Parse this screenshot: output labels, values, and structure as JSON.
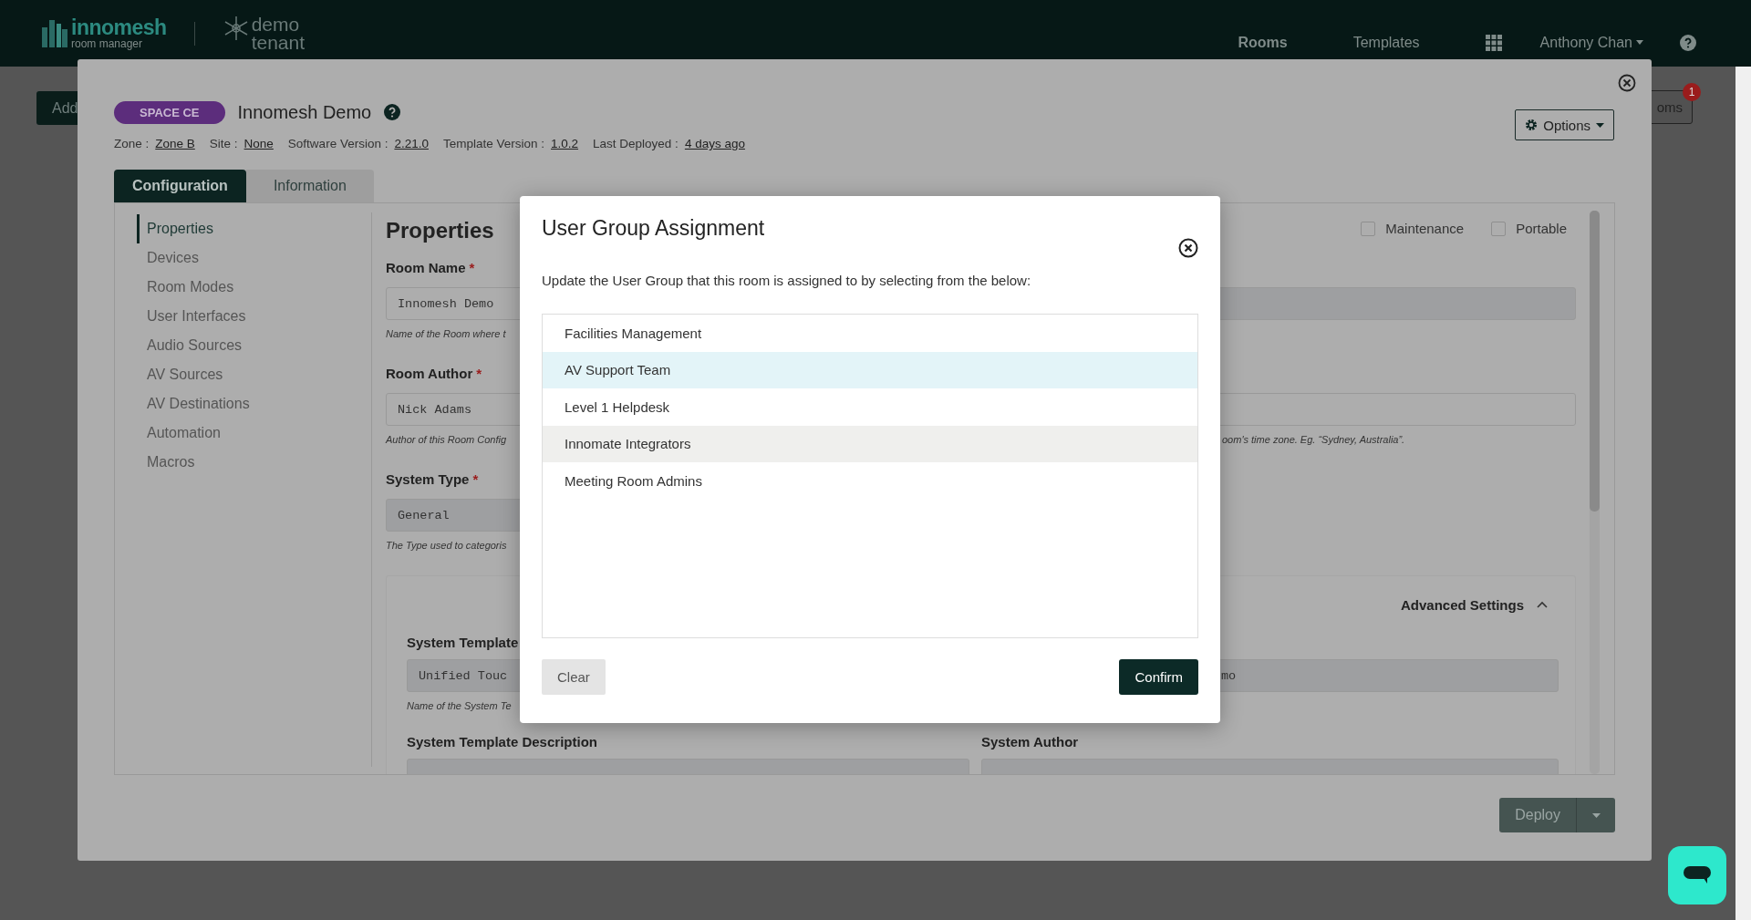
{
  "top_bar": {
    "logo": {
      "name": "innomesh",
      "tagline": "room manager"
    },
    "tenant": [
      "demo",
      "tenant"
    ],
    "nav": [
      {
        "label": "Rooms",
        "selected": true
      },
      {
        "label": "Templates",
        "selected": false
      }
    ],
    "user": "Anthony Chan"
  },
  "background": {
    "add_button": "Add",
    "rooms_button": "oms",
    "rooms_badge": "1"
  },
  "room_modal": {
    "badge": "SPACE CE",
    "title": "Innomesh Demo",
    "meta": [
      {
        "label": "Zone :",
        "value": "Zone B"
      },
      {
        "label": "Site :",
        "value": "None"
      },
      {
        "label": "Software Version :",
        "value": "2.21.0"
      },
      {
        "label": "Template Version :",
        "value": "1.0.2"
      },
      {
        "label": "Last Deployed :",
        "value": "4 days ago"
      }
    ],
    "options_button": "Options",
    "tabs": [
      {
        "label": "Configuration",
        "selected": true
      },
      {
        "label": "Information",
        "selected": false
      }
    ],
    "sidebar": {
      "items": [
        {
          "label": "Properties",
          "selected": true
        },
        {
          "label": "Devices",
          "selected": false
        },
        {
          "label": "Room Modes",
          "selected": false
        },
        {
          "label": "User Interfaces",
          "selected": false
        },
        {
          "label": "Audio Sources",
          "selected": false
        },
        {
          "label": "AV Sources",
          "selected": false
        },
        {
          "label": "AV Destinations",
          "selected": false
        },
        {
          "label": "Automation",
          "selected": false
        },
        {
          "label": "Macros",
          "selected": false
        }
      ]
    },
    "properties": {
      "heading": "Properties",
      "flags": [
        {
          "label": "Maintenance",
          "checked": false
        },
        {
          "label": "Portable",
          "checked": false
        }
      ],
      "rows": [
        {
          "left": {
            "label": "Room Name",
            "required_mark": "*",
            "value": "Innomesh Demo",
            "hint": "Name of the Room where t",
            "disabled": false
          },
          "right": {
            "disabled": true
          }
        },
        {
          "left": {
            "label": "Room Author",
            "required_mark": "*",
            "value": "Nick Adams",
            "hint": "Author of this Room Config",
            "disabled": false
          },
          "right": {
            "disabled": false,
            "hint": "oom's time zone. Eg. “Sydney, Australia”."
          }
        },
        {
          "left": {
            "label": "System Type",
            "required_mark": "*",
            "value": "General",
            "hint": "The Type used to categoris",
            "disabled": true
          }
        }
      ],
      "advanced": {
        "title": "Advanced Settings",
        "expanded": true,
        "rows": [
          {
            "left": {
              "label": "System Template",
              "value": "Unified Touc",
              "hint": "Name of the System Te",
              "disabled": true
            },
            "right": {
              "value": "mo",
              "disabled": true
            }
          },
          {
            "left": {
              "label": "System Template Description",
              "disabled": true
            },
            "right": {
              "label": "System Author",
              "disabled": true
            }
          }
        ]
      }
    },
    "deploy_button": "Deploy"
  },
  "dialog": {
    "title": "User Group Assignment",
    "description": "Update the User Group that this room is assigned to by selecting from the below:",
    "groups": [
      {
        "label": "Facilities Management",
        "selected": false,
        "hovered": false
      },
      {
        "label": "AV Support Team",
        "selected": true,
        "hovered": false
      },
      {
        "label": "Level 1 Helpdesk",
        "selected": false,
        "hovered": false
      },
      {
        "label": "Innomate Integrators",
        "selected": false,
        "hovered": true
      },
      {
        "label": "Meeting Room Admins",
        "selected": false,
        "hovered": false
      }
    ],
    "clear_button": "Clear",
    "confirm_button": "Confirm"
  }
}
